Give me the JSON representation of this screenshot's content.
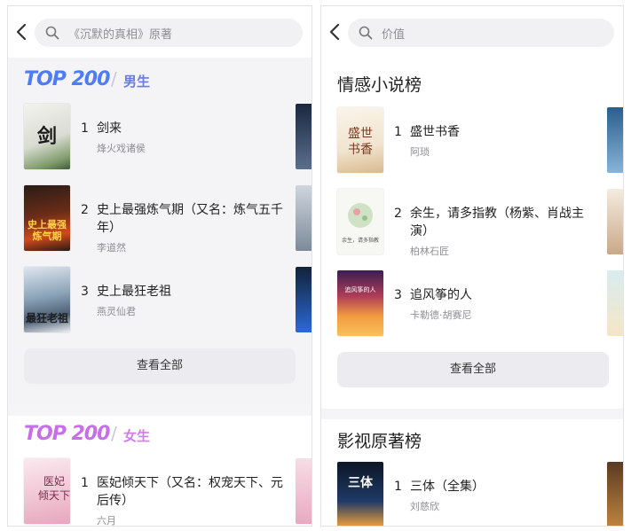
{
  "left": {
    "search_placeholder": "《沉默的真相》原著",
    "male_section": {
      "logo": "TOP 200",
      "label": "男生",
      "books": [
        {
          "rank": "1",
          "title": "剑来",
          "author": "烽火戏诸侯",
          "cover_text": "剑来"
        },
        {
          "rank": "2",
          "title": "史上最强炼气期（又名：炼气五千年）",
          "author": "李道然",
          "cover_text": "史上最强炼气期"
        },
        {
          "rank": "3",
          "title": "史上最狂老祖",
          "author": "燕灵仙君",
          "cover_text": "最狂老祖"
        }
      ],
      "view_all": "查看全部"
    },
    "female_section": {
      "logo": "TOP 200",
      "label": "女生",
      "books": [
        {
          "rank": "1",
          "title": "医妃倾天下（又名：权宠天下、元后传）",
          "author": "六月",
          "cover_text": "医妃倾天下"
        }
      ]
    }
  },
  "right": {
    "search_placeholder": "价值",
    "emotion_section": {
      "title": "情感小说榜",
      "books": [
        {
          "rank": "1",
          "title": "盛世书香",
          "author": "阿琐",
          "cover_text": "盛世书香"
        },
        {
          "rank": "2",
          "title": "余生，请多指教（杨紫、肖战主演）",
          "author": "柏林石匠",
          "cover_text": "余生，请多指教"
        },
        {
          "rank": "3",
          "title": "追风筝的人",
          "author": "卡勒德·胡赛尼",
          "cover_text": "追风筝的人"
        }
      ],
      "view_all": "查看全部"
    },
    "film_section": {
      "title": "影视原著榜",
      "books": [
        {
          "rank": "1",
          "title": "三体（全集）",
          "author": "刘慈欣",
          "cover_text": "三体"
        }
      ]
    }
  },
  "colors": {
    "male_accent": "#4d7cf6",
    "female_accent": "#c86ee8"
  }
}
